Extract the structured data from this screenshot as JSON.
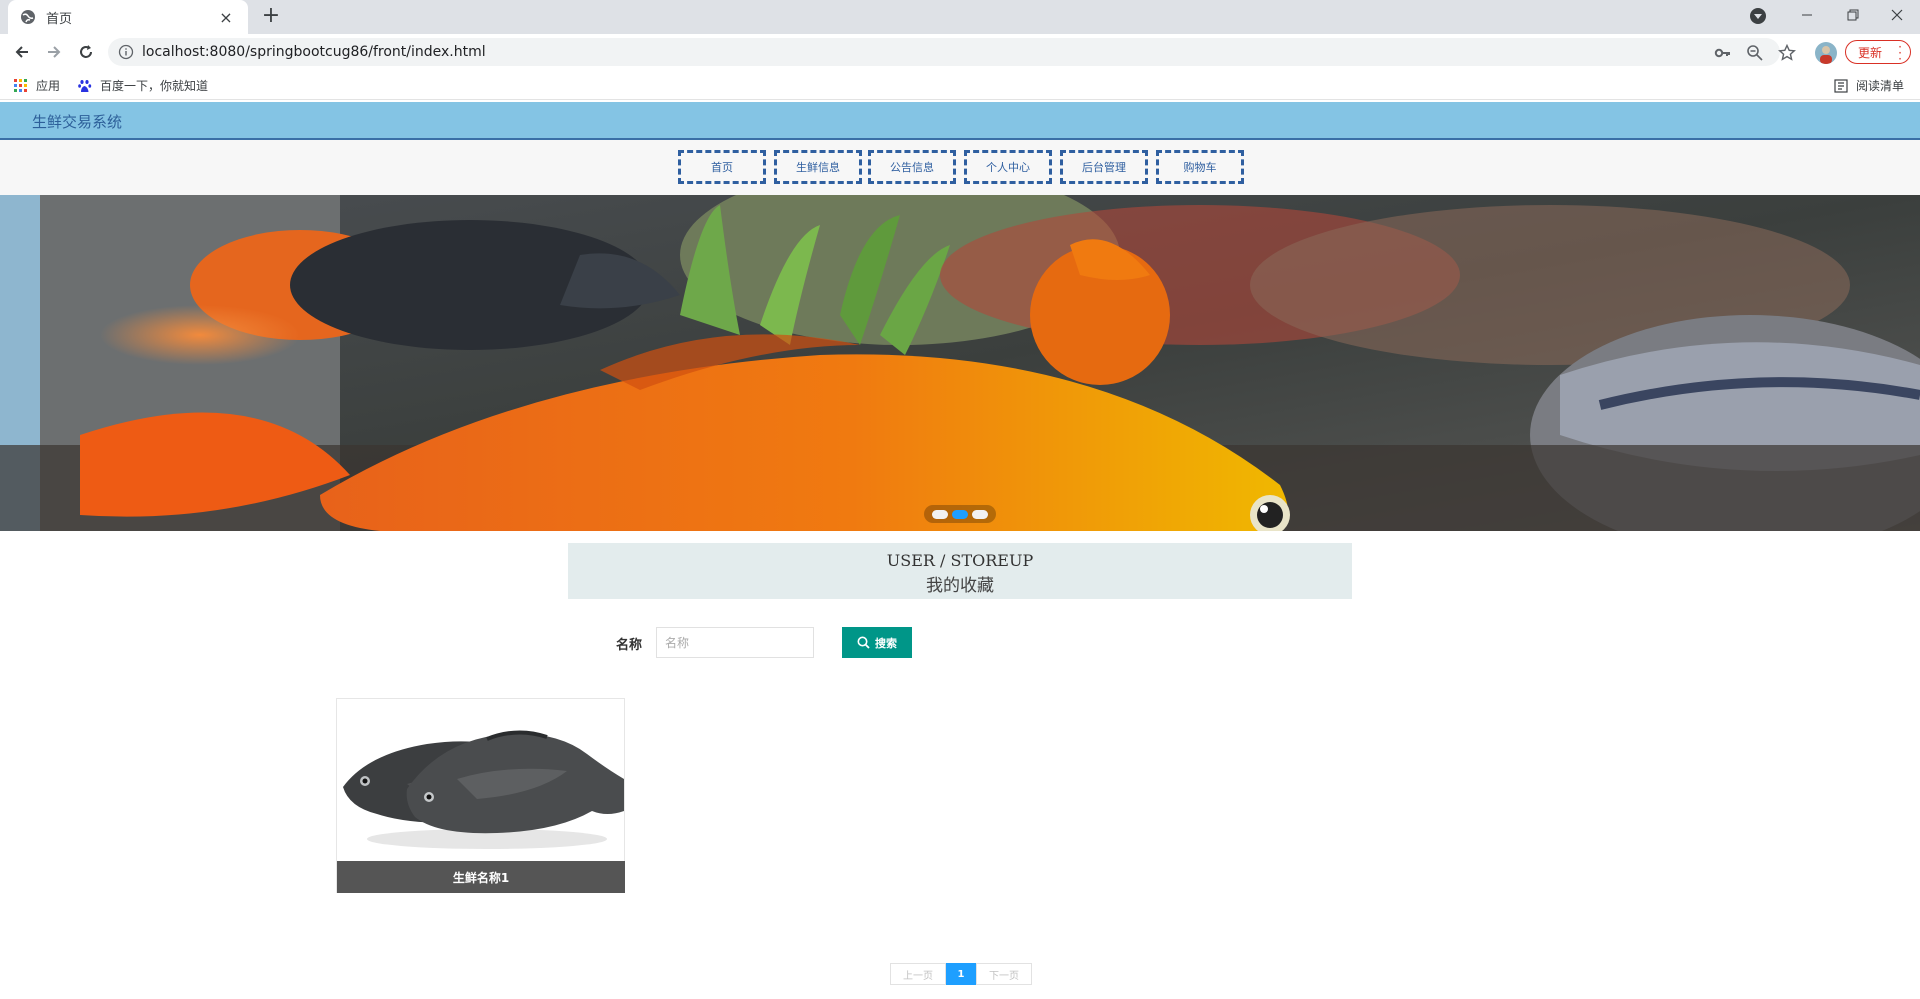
{
  "browser": {
    "tab_title": "首页",
    "tab_close": "×",
    "new_tab": "+",
    "url": "localhost:8080/springbootcug86/front/index.html",
    "update_label": "更新",
    "bookmarks": [
      {
        "label": "应用",
        "icon": "apps-grid-icon"
      },
      {
        "label": "百度一下，你就知道",
        "icon": "baidu-paw-icon"
      }
    ],
    "reading_list": "阅读清单"
  },
  "site": {
    "title": "生鲜交易系统",
    "nav": [
      "首页",
      "生鲜信息",
      "公告信息",
      "个人中心",
      "后台管理",
      "购物车"
    ]
  },
  "carousel": {
    "slide_count": 3,
    "active_index": 1
  },
  "section": {
    "title_en": "USER / STOREUP",
    "title_cn": "我的收藏"
  },
  "search": {
    "label": "名称",
    "placeholder": "名称",
    "button_label": "搜索"
  },
  "products": [
    {
      "name": "生鲜名称1"
    }
  ],
  "pagination": {
    "prev": "上一页",
    "current": "1",
    "next": "下一页"
  },
  "colors": {
    "header_bg": "#84c4e4",
    "nav_border": "#2f5fa0",
    "search_button": "#009688",
    "page_active": "#1e9fff"
  }
}
